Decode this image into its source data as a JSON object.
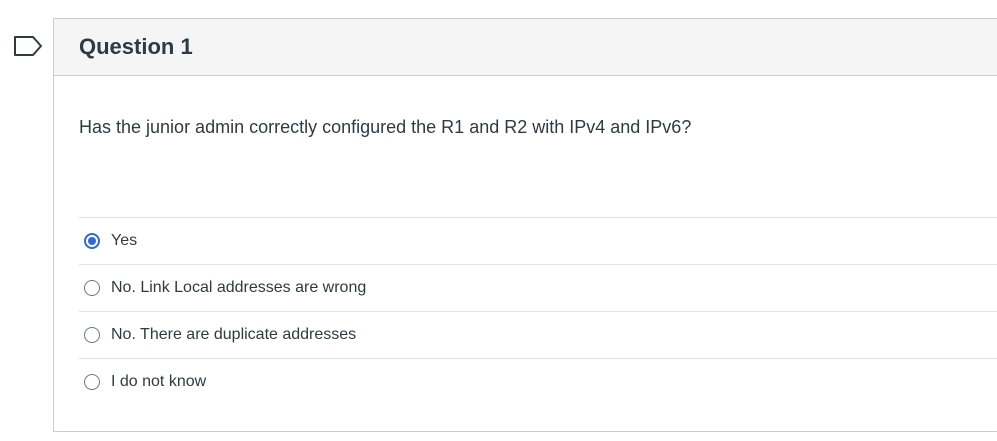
{
  "question": {
    "title": "Question 1",
    "text": "Has the junior admin correctly configured the R1 and R2 with IPv4 and IPv6?"
  },
  "answers": [
    {
      "label": "Yes",
      "selected": true
    },
    {
      "label": "No. Link Local addresses are wrong",
      "selected": false
    },
    {
      "label": "No. There are duplicate addresses",
      "selected": false
    },
    {
      "label": "I do not know",
      "selected": false
    }
  ],
  "colors": {
    "accent": "#2d6bd6",
    "text": "#2d3b45",
    "header_bg": "#f5f5f5",
    "border": "#c7cdd1"
  },
  "icons": {
    "flag": "flag-question-icon"
  }
}
